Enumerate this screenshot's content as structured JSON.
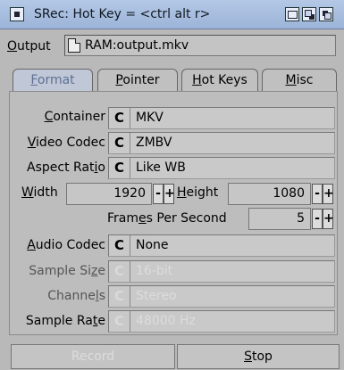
{
  "window": {
    "title": "SRec: Hot Key = <ctrl alt r>",
    "icons": [
      "close-icon",
      "zoom-icon",
      "depth-icon"
    ]
  },
  "output": {
    "label_first": "O",
    "label_rest": "utput",
    "value": "RAM:output.mkv",
    "icon": "file-icon"
  },
  "tabs": [
    {
      "first": "F",
      "rest": "ormat",
      "active": true
    },
    {
      "first": "P",
      "rest": "ointer",
      "active": false
    },
    {
      "first": "H",
      "rest": "ot Keys",
      "active": false
    },
    {
      "first": "M",
      "rest": "isc",
      "active": false
    }
  ],
  "format": {
    "container": {
      "label_first": "C",
      "label_rest": "ontainer",
      "value": "MKV"
    },
    "video_codec": {
      "label_first": "V",
      "label_rest": "ideo Codec",
      "value": "ZMBV"
    },
    "aspect_ratio": {
      "label_pre": "Aspect Rat",
      "label_u": "i",
      "label_post": "o",
      "value": "Like WB"
    },
    "width": {
      "label_first": "W",
      "label_rest": "idth",
      "value": "1920"
    },
    "height": {
      "label_first": "H",
      "label_rest": "eight",
      "value": "1080"
    },
    "fps": {
      "label_pre": "Fram",
      "label_u": "e",
      "label_post": "s Per Second",
      "value": "5"
    },
    "audio_codec": {
      "label_first": "A",
      "label_rest": "udio Codec",
      "value": "None"
    },
    "sample_size": {
      "label_pre": "Sample Si",
      "label_u": "z",
      "label_post": "e",
      "value": "16-bit"
    },
    "channels": {
      "label_pre": "Channe",
      "label_u": "l",
      "label_post": "s",
      "value": "Stereo"
    },
    "sample_rate": {
      "label_pre": "Sample Ra",
      "label_u": "t",
      "label_post": "e",
      "value": "48000 Hz"
    },
    "cycle_glyph": "C",
    "stepper_minus": "-",
    "stepper_plus": "+"
  },
  "buttons": {
    "record": "Record",
    "stop_first": "S",
    "stop_rest": "top"
  },
  "colors": {
    "titlebar": "#a8bee0",
    "active_tab_text": "#5f6f93",
    "disabled_text": "#dcdcdc"
  }
}
